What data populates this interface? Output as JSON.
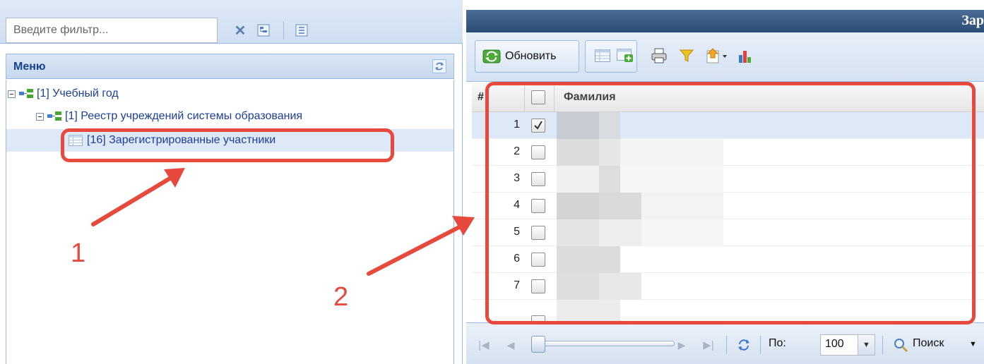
{
  "filter": {
    "placeholder": "Введите фильтр...",
    "value": ""
  },
  "menu": {
    "title": "Меню"
  },
  "tree": {
    "nodes": [
      {
        "label": "[1] Учебный год"
      },
      {
        "label": "[1] Реестр учреждений системы образования"
      },
      {
        "label": "[16] Зарегистрированные участники"
      }
    ]
  },
  "right_panel": {
    "title": "Зар"
  },
  "toolbar": {
    "refresh_label": "Обновить"
  },
  "grid": {
    "columns": {
      "row_number": "#",
      "surname": "Фамилия"
    },
    "rows": [
      {
        "n": "1",
        "checked": true
      },
      {
        "n": "2",
        "checked": false
      },
      {
        "n": "3",
        "checked": false
      },
      {
        "n": "4",
        "checked": false
      },
      {
        "n": "5",
        "checked": false
      },
      {
        "n": "6",
        "checked": false
      },
      {
        "n": "7",
        "checked": false
      }
    ]
  },
  "pager": {
    "per_page_label": "По:",
    "per_page_value": "100",
    "search_label": "Поиск"
  },
  "annotations": {
    "label_1": "1",
    "label_2": "2"
  },
  "colors": {
    "annotation_red": "#e8493d",
    "header_dark_blue": "#2c4c74",
    "link_blue": "#1a3fa0"
  }
}
